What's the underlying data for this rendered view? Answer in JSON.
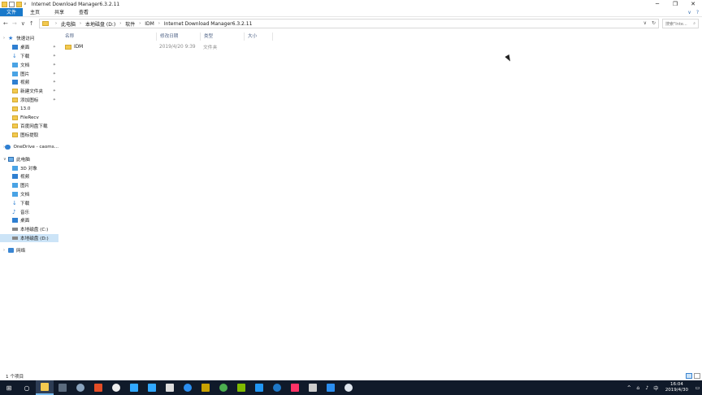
{
  "window": {
    "title": "Internet Download Manager6.3.2.11",
    "controls": {
      "minimize": "─",
      "maximize": "❐",
      "close": "✕"
    }
  },
  "ribbon": {
    "tabs": [
      "文件",
      "主页",
      "共享",
      "查看"
    ],
    "expand": "∨",
    "help": "?"
  },
  "address": {
    "crumbs": [
      "此电脑",
      "本地磁盘 (D:)",
      "软件",
      "IDM",
      "Internet Download Manager6.3.2.11"
    ],
    "dropdown": "∨",
    "refresh": "↻",
    "search_placeholder": "搜索\"Inte...",
    "search_icon": "⌕"
  },
  "nav_buttons": {
    "back": "←",
    "forward": "→",
    "recent": "∨",
    "up": "↑"
  },
  "sidebar": {
    "quick_access": {
      "label": "快速访问",
      "items": [
        {
          "label": "桌面",
          "icon": "desktop-icon",
          "pinned": true
        },
        {
          "label": "下载",
          "icon": "download-icon",
          "pinned": true
        },
        {
          "label": "文档",
          "icon": "documents-icon",
          "pinned": true
        },
        {
          "label": "图片",
          "icon": "pictures-icon",
          "pinned": true
        },
        {
          "label": "视频",
          "icon": "videos-icon",
          "pinned": true
        },
        {
          "label": "新建文件夹",
          "icon": "folder-icon",
          "pinned": true
        },
        {
          "label": "添加图标",
          "icon": "folder-icon",
          "pinned": true
        },
        {
          "label": "13.0",
          "icon": "folder-icon",
          "pinned": false
        },
        {
          "label": "FileRecv",
          "icon": "folder-icon",
          "pinned": false
        },
        {
          "label": "百度网盘下载",
          "icon": "folder-icon",
          "pinned": false
        },
        {
          "label": "图标提取",
          "icon": "folder-icon",
          "pinned": false
        }
      ]
    },
    "onedrive": {
      "label": "OneDrive - caoms..."
    },
    "this_pc": {
      "label": "此电脑",
      "items": [
        {
          "label": "3D 对象",
          "icon": "3d-objects-icon"
        },
        {
          "label": "视频",
          "icon": "videos-icon"
        },
        {
          "label": "图片",
          "icon": "pictures-icon"
        },
        {
          "label": "文档",
          "icon": "documents-icon"
        },
        {
          "label": "下载",
          "icon": "download-icon"
        },
        {
          "label": "音乐",
          "icon": "music-icon"
        },
        {
          "label": "桌面",
          "icon": "desktop-icon"
        },
        {
          "label": "本地磁盘 (C:)",
          "icon": "drive-icon"
        },
        {
          "label": "本地磁盘 (D:)",
          "icon": "drive-icon",
          "selected": true
        }
      ]
    },
    "network": {
      "label": "网络"
    }
  },
  "columns": [
    "名称",
    "修改日期",
    "类型",
    "大小"
  ],
  "files": [
    {
      "name": "IDM",
      "modified": "2019/4/20 9:39",
      "type": "文件夹",
      "size": ""
    }
  ],
  "status": {
    "count": "1 个项目"
  },
  "taskbar": {
    "clock": {
      "time": "16:04",
      "date": "2019/4/30"
    },
    "tray_icons": [
      "^",
      "⌂",
      "♪",
      "中"
    ],
    "app_colors": [
      "#1e78c8",
      "#31a8ff",
      "#e44d26",
      "#7fba00",
      "#2196f3",
      "#c9a200",
      "#ff3366",
      "#2b8ef0"
    ]
  }
}
